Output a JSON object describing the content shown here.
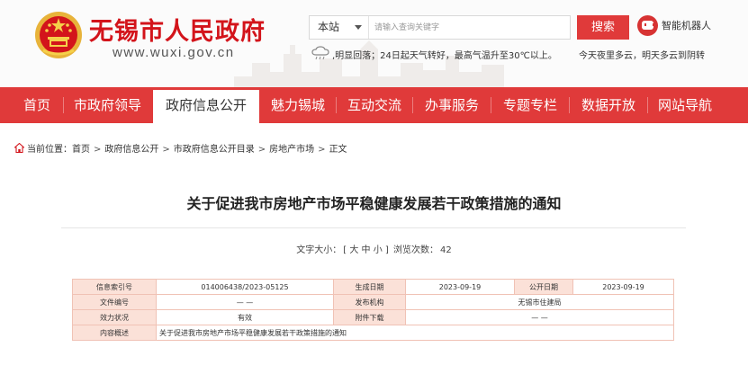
{
  "header": {
    "site_title": "无锡市人民政府",
    "site_url": "www.wuxi.gov.cn",
    "search": {
      "scope": "本站",
      "placeholder": "请输入查询关键字",
      "button_label": "搜索"
    },
    "robot_label": "智能机器人",
    "weather": {
      "icon": "cloud-rain-icon",
      "text": ",明显回落；24日起天气转好，最高气温升至30℃以上。",
      "forecast": "今天夜里多云，明天多云到阴转"
    }
  },
  "nav": {
    "items": [
      {
        "label": "首页"
      },
      {
        "label": "市政府领导"
      },
      {
        "label": "政府信息公开"
      },
      {
        "label": "魅力锡城"
      },
      {
        "label": "互动交流"
      },
      {
        "label": "办事服务"
      },
      {
        "label": "专题专栏"
      },
      {
        "label": "数据开放"
      },
      {
        "label": "网站导航"
      }
    ],
    "active_index": 2
  },
  "breadcrumb": {
    "prefix": "当前位置：",
    "items": [
      "首页",
      "政府信息公开",
      "市政府信息公开目录",
      "房地产市场",
      "正文"
    ],
    "separator": ">"
  },
  "article": {
    "title": "关于促进我市房地产市场平稳健康发展若干政策措施的通知",
    "font_size_label": "文字大小：",
    "font_size_options": "[ 大 中 小 ]",
    "views_label": "浏览次数：",
    "views_count": "42"
  },
  "info_table": {
    "row1": {
      "k1": "信息索引号",
      "v1": "014006438/2023-05125",
      "k2": "生成日期",
      "v2": "2023-09-19",
      "k3": "公开日期",
      "v3": "2023-09-19"
    },
    "row2": {
      "k1": "文件编号",
      "v1": "— —",
      "k2": "发布机构",
      "v2": "无锡市住建局"
    },
    "row3": {
      "k1": "效力状况",
      "v1": "有效",
      "k2": "附件下载",
      "v2": "— —"
    },
    "row4": {
      "k1": "内容概述",
      "v1": "关于促进我市房地产市场平稳健康发展若干政策措施的通知"
    }
  },
  "colors": {
    "brand_red": "#d3141b",
    "nav_red": "#e03a3a",
    "table_key_bg": "#fbe1d8",
    "table_border": "#f0c2b5"
  }
}
